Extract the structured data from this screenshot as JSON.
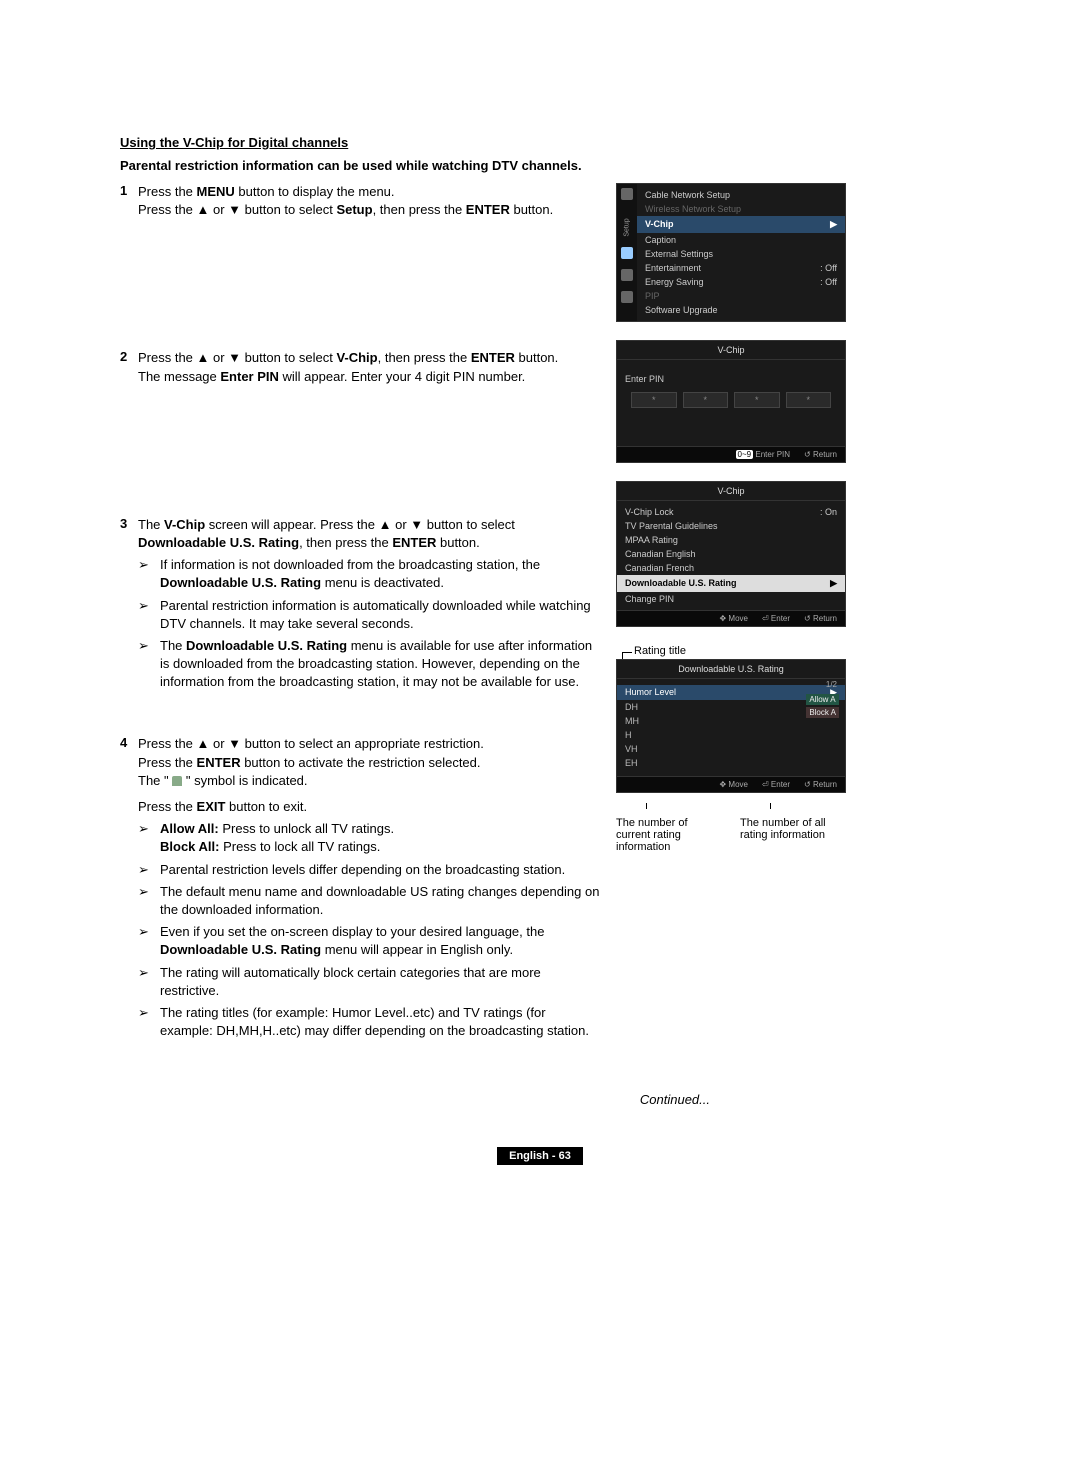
{
  "heading": "Using the V-Chip for Digital channels",
  "subheading": "Parental restriction information can be used while watching DTV channels.",
  "steps": {
    "s1": {
      "num": "1",
      "l1a": "Press the ",
      "l1b": "MENU",
      "l1c": " button to display the menu.",
      "l2a": "Press the ▲ or ▼ button to select ",
      "l2b": "Setup",
      "l2c": ", then press the ",
      "l2d": "ENTER",
      "l2e": " button."
    },
    "s2": {
      "num": "2",
      "l1a": "Press the ▲ or ▼ button to select ",
      "l1b": "V-Chip",
      "l1c": ", then press the ",
      "l1d": "ENTER",
      "l1e": " button.",
      "l2a": "The message ",
      "l2b": "Enter PIN",
      "l2c": " will appear. Enter your 4 digit PIN number."
    },
    "s3": {
      "num": "3",
      "l1a": "The ",
      "l1b": "V-Chip",
      "l1c": " screen will appear. Press the ▲ or ▼ button to select ",
      "l2a": "Downloadable U.S. Rating",
      "l2b": ", then press the ",
      "l2c": "ENTER",
      "l2d": " button.",
      "b1a": "If information is not downloaded from the broadcasting station, the ",
      "b1b": "Downloadable U.S. Rating",
      "b1c": " menu is deactivated.",
      "b2": "Parental restriction information is automatically downloaded while watching DTV channels. It may take several seconds.",
      "b3a": "The ",
      "b3b": "Downloadable U.S. Rating",
      "b3c": " menu is available for use after information is downloaded from the broadcasting station. However, depending on the information from the broadcasting station, it may not be available for use."
    },
    "s4": {
      "num": "4",
      "l1": "Press the ▲ or ▼ button to select an appropriate restriction.",
      "l2a": "Press the ",
      "l2b": "ENTER",
      "l2c": " button to activate the restriction selected.",
      "l3a": "The \" ",
      "l3b": " \" symbol is indicated.",
      "l4a": "Press the ",
      "l4b": "EXIT",
      "l4c": " button to exit.",
      "b1a": "Allow All:",
      "b1b": " Press to unlock all TV ratings.",
      "b1c": "Block All:",
      "b1d": " Press to lock all TV ratings.",
      "b2": "Parental restriction levels differ depending on the broadcasting station.",
      "b3": "The default menu name and downloadable US rating changes depending on the downloaded information.",
      "b4a": "Even if you set the on-screen display to your desired language, the ",
      "b4b": "Downloadable U.S. Rating",
      "b4c": " menu will appear in English only.",
      "b5": "The rating will automatically block certain categories that are more restrictive.",
      "b6": "The rating titles (for example: Humor Level..etc) and TV ratings (for example: DH,MH,H..etc) may differ depending on the broadcasting station."
    }
  },
  "panel1": {
    "setup_label": "Setup",
    "items": {
      "cable": "Cable Network Setup",
      "wireless": "Wireless Network Setup",
      "vchip": "V-Chip",
      "caption": "Caption",
      "external": "External Settings",
      "entertainment": "Entertainment",
      "entertainment_v": ": Off",
      "energy": "Energy Saving",
      "energy_v": ": Off",
      "pip": "PIP",
      "upgrade": "Software Upgrade"
    }
  },
  "panel2": {
    "title": "V-Chip",
    "enter_pin": "Enter PIN",
    "star": "*",
    "footer_pin_btn": "0~9",
    "footer_pin": "Enter PIN",
    "footer_return_icon": "↺",
    "footer_return": "Return"
  },
  "panel3": {
    "title": "V-Chip",
    "lock": "V-Chip Lock",
    "lock_v": ": On",
    "tvpg": "TV Parental Guidelines",
    "mpaa": "MPAA Rating",
    "ce": "Canadian English",
    "cf": "Canadian French",
    "dlus": "Downloadable U.S. Rating",
    "cpin": "Change PIN",
    "footer_move_icon": "✥",
    "footer_move": "Move",
    "footer_enter_icon": "⏎",
    "footer_enter": "Enter",
    "footer_return_icon": "↺",
    "footer_return": "Return"
  },
  "panel4": {
    "rating_title_label": "Rating title",
    "title": "Downloadable U.S. Rating",
    "humor": "Humor Level",
    "page": "1/2",
    "r1": "DH",
    "r2": "MH",
    "r3": "H",
    "r4": "VH",
    "r5": "EH",
    "tag_allow": "Allow A",
    "tag_block": "Block A",
    "footer_move_icon": "✥",
    "footer_move": "Move",
    "footer_enter_icon": "⏎",
    "footer_enter": "Enter",
    "footer_return_icon": "↺",
    "footer_return": "Return",
    "ann_left": "The number of current rating information",
    "ann_right": "The number of all rating information"
  },
  "arrow_r": "▶",
  "bullet_glyph": "➢",
  "continued": "Continued...",
  "pagenum": "English - 63"
}
